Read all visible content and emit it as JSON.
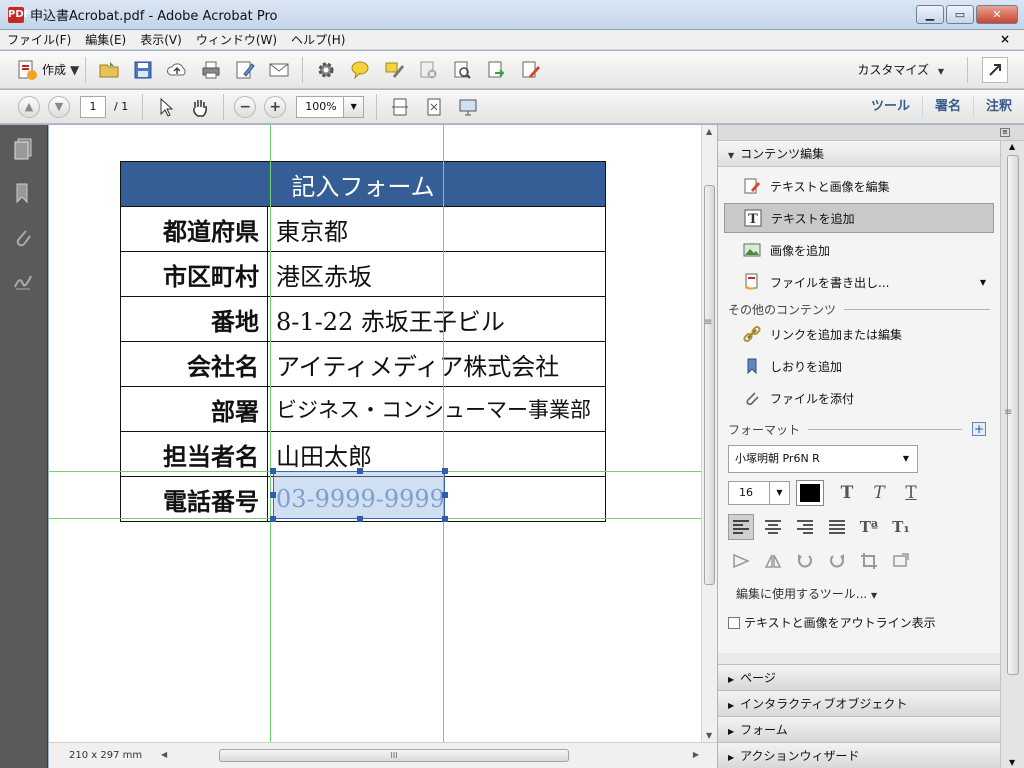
{
  "window": {
    "title": "申込書Acrobat.pdf - Adobe Acrobat Pro",
    "app_icon": "PDF",
    "min": "▁",
    "max": "▭",
    "close": "✕"
  },
  "menu": {
    "items": [
      "ファイル(F)",
      "編集(E)",
      "表示(V)",
      "ウィンドウ(W)",
      "ヘルプ(H)"
    ],
    "close_doc": "×"
  },
  "toolbar": {
    "create_label": "作成",
    "customize_label": "カスタマイズ",
    "caret": "▼"
  },
  "nav": {
    "page_current": "1",
    "page_total": "/ 1",
    "zoom": "100%",
    "tabs": [
      "ツール",
      "署名",
      "注釈"
    ]
  },
  "document": {
    "page_size": "210 x 297 mm",
    "form_title": "記入フォーム",
    "rows": [
      {
        "label": "都道府県",
        "value": "東京都"
      },
      {
        "label": "市区町村",
        "value": "港区赤坂"
      },
      {
        "label": "番地",
        "value": "8-1-22 赤坂王子ビル"
      },
      {
        "label": "会社名",
        "value": "アイティメディア株式会社"
      },
      {
        "label": "部署",
        "value": "ビジネス・コンシューマー事業部"
      },
      {
        "label": "担当者名",
        "value": "山田太郎"
      },
      {
        "label": "電話番号",
        "value": "03-9999-9999"
      }
    ],
    "scroll_grip": "III"
  },
  "panel": {
    "section_content_edit": "コンテンツ編集",
    "items": [
      {
        "label": "テキストと画像を編集",
        "icon": "edit-text-image-icon"
      },
      {
        "label": "テキストを追加",
        "icon": "add-text-icon"
      },
      {
        "label": "画像を追加",
        "icon": "add-image-icon"
      },
      {
        "label": "ファイルを書き出し...",
        "icon": "export-file-icon"
      }
    ],
    "other_content_label": "その他のコンテンツ",
    "other_items": [
      {
        "label": "リンクを追加または編集",
        "icon": "link-icon"
      },
      {
        "label": "しおりを追加",
        "icon": "bookmark-icon"
      },
      {
        "label": "ファイルを添付",
        "icon": "paperclip-icon"
      }
    ],
    "format_label": "フォーマット",
    "font_name": "小塚明朝 Pr6N R",
    "font_size": "16",
    "text_color": "#000000",
    "edit_tools_label": "編集に使用するツール...",
    "outline_checkbox_label": "テキストと画像をアウトライン表示",
    "collapsed_sections": [
      "ページ",
      "インタラクティブオブジェクト",
      "フォーム",
      "アクションウィザード"
    ],
    "format_buttons": {
      "T1": "T",
      "T2": "T",
      "T3": "T",
      "sup": "Tª",
      "sub": "T₁"
    }
  }
}
